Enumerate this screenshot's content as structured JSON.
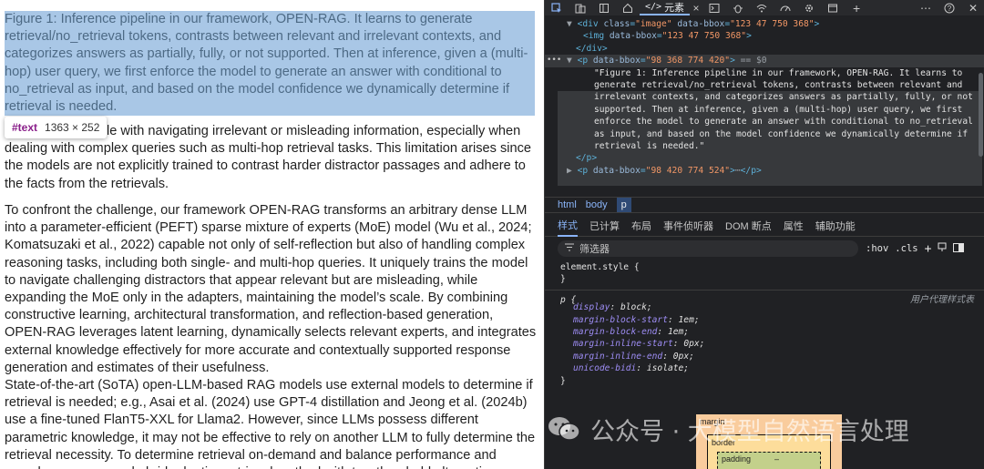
{
  "document": {
    "caption": "Figure 1: Inference pipeline in our framework, OPEN-RAG. It learns to generate retrieval/no_retrieval tokens, contrasts between relevant and irrelevant contexts, and categorizes answers as partially, fully, or not supported. Then at inference, given a (multi-hop) user query, we first enforce the model to generate an answer with conditional to no_retrieval as input, and based on the model confidence we dynamically determine if retrieval is needed.",
    "para1": "ation, they struggle with navigating irrelevant or misleading information, especially when dealing with complex queries such as multi-hop retrieval tasks. This limitation arises since the models are not explicitly trained to contrast harder distractor passages and adhere to the facts from the retrievals.",
    "para2": "To confront the challenge, our framework OPEN-RAG transforms an arbitrary dense LLM into a parameter-efficient (PEFT) sparse mixture of experts (MoE) model (Wu et al., 2024; Komatsuzaki et al., 2022) capable not only of self-reflection but also of handling complex reasoning tasks, including both single- and multi-hop queries. It uniquely trains the model to navigate challenging distractors that appear relevant but are misleading, while expanding the MoE only in the adapters, maintaining the model’s scale. By combining constructive learning, architectural transformation, and reflection-based generation, OPEN-RAG leverages latent learning, dynamically selects relevant experts, and integrates external knowledge effectively for more accurate and contextually supported response generation and estimates of their usefulness.",
    "para3": "State-of-the-art (SoTA) open-LLM-based RAG models use external models to determine if retrieval is needed; e.g., Asai et al. (2024) use GPT-4 distillation and Jeong et al. (2024b) use a fine-tuned FlanT5-XXL for Llama2. However, since LLMs possess different parametric knowledge, it may not be effective to rely on another LLM to fully determine the retrieval necessity. To determine retrieval on-demand and balance performance and speed, we propose a hybrid adaptive retrieval method with two threshold alternatives",
    "tooltip_tag": "#text",
    "tooltip_size": "1363 × 252"
  },
  "toolbar": {
    "elements_tab": "元素",
    "icons": [
      "inspect-icon",
      "device-icon",
      "panel-icon",
      "home-icon",
      "elements-icon",
      "console-icon",
      "bug-icon",
      "wifi-icon",
      "performance-icon",
      "settings-gear-icon",
      "window-icon",
      "add-icon",
      "more-icon",
      "help-icon",
      "close-icon"
    ]
  },
  "code": {
    "l1_tag": "div",
    "l1_attr1": "class",
    "l1_val1": "\"image\"",
    "l1_attr2": "data-bbox",
    "l1_val2": "\"123 47 750 368\"",
    "l2_tag": "img",
    "l2_attr": "data-bbox",
    "l2_val": "\"123 47 750 368\"",
    "l3": "</div>",
    "l4_tag": "p",
    "l4_attr": "data-bbox",
    "l4_val": "\"98 368 774 420\"",
    "l4_eq": "== $0",
    "text_lines": [
      "\"Figure 1: Inference pipeline in our framework, OPEN-RAG. It learns to",
      "generate retrieval/no_retrieval tokens, contrasts between relevant and",
      "irrelevant contexts, and categorizes answers as partially, fully, or not",
      "supported. Then at inference, given a (multi-hop) user query, we first",
      "enforce the model to generate an answer with conditional to no_retrieval",
      "as input, and based on the model confidence we dynamically determine if",
      "retrieval is needed.\""
    ],
    "l_close": "</p>",
    "l_next_tag": "p",
    "l_next_attr": "data-bbox",
    "l_next_val": "\"98 420 774 524\"",
    "l_next_tail": "</p>"
  },
  "breadcrumbs": [
    "html",
    "body",
    "p"
  ],
  "tabs": [
    "样式",
    "已计算",
    "布局",
    "事件侦听器",
    "DOM 断点",
    "属性",
    "辅助功能"
  ],
  "filter": {
    "placeholder": "筛选器",
    "hov": ":hov",
    "cls": ".cls"
  },
  "styles": {
    "element_style": "element.style {",
    "close": "}",
    "p_rule": "p {",
    "ua_label": "用户代理样式表",
    "props": [
      {
        "name": "display",
        "value": "block;"
      },
      {
        "name": "margin-block-start",
        "value": "1em;"
      },
      {
        "name": "margin-block-end",
        "value": "1em;"
      },
      {
        "name": "margin-inline-start",
        "value": "0px;"
      },
      {
        "name": "margin-inline-end",
        "value": "0px;"
      },
      {
        "name": "unicode-bidi",
        "value": "isolate;"
      }
    ]
  },
  "boxmodel": {
    "margin": "margin",
    "border": "border",
    "padding": "padding",
    "dash": "–"
  },
  "watermark": {
    "text": "公众号 · 大模型自然语言处理"
  }
}
